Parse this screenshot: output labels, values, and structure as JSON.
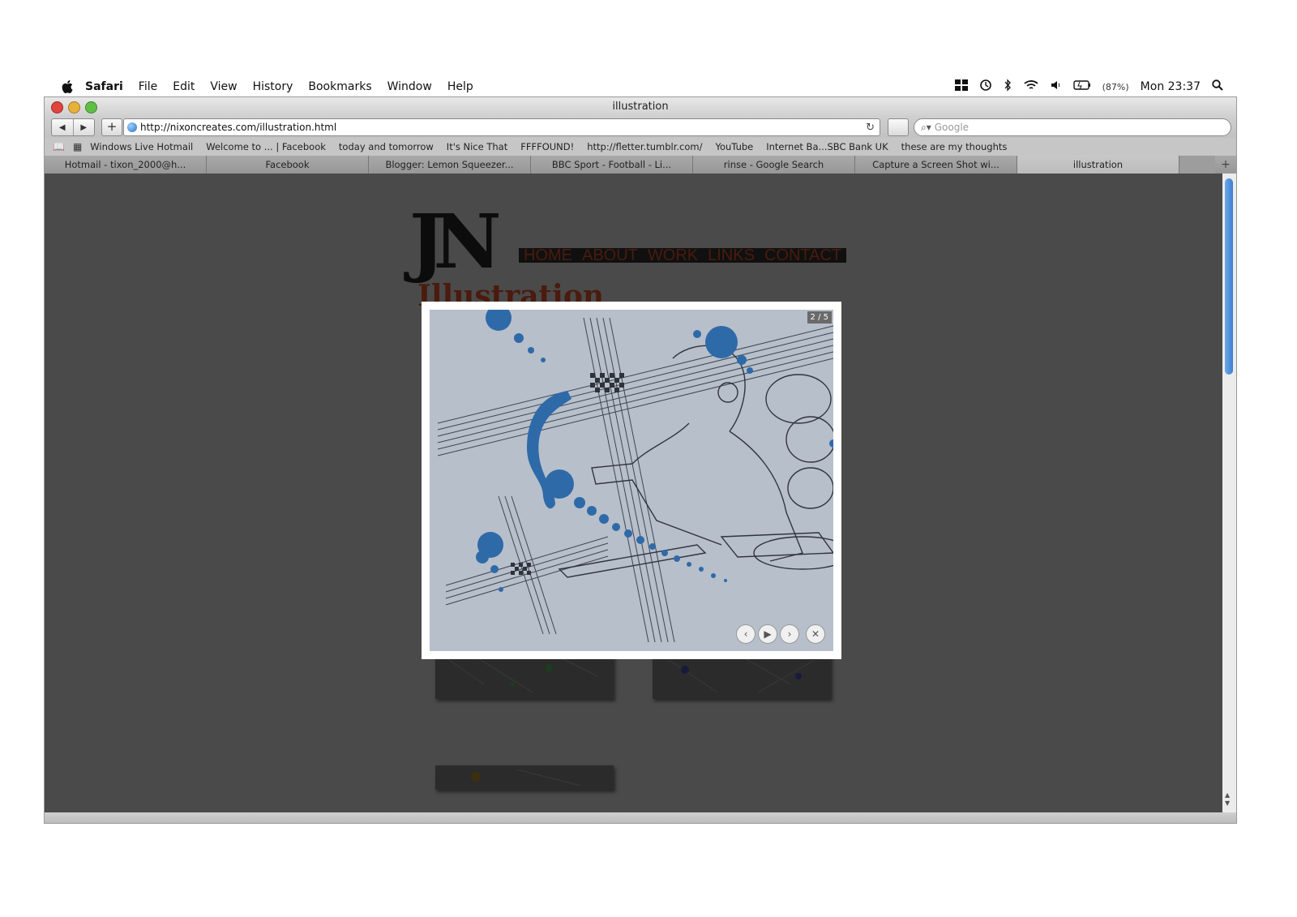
{
  "menubar": {
    "app": "Safari",
    "items": [
      "File",
      "Edit",
      "View",
      "History",
      "Bookmarks",
      "Window",
      "Help"
    ],
    "battery": "(87%)",
    "clock": "Mon 23:37",
    "icons": [
      "apple-icon",
      "spaces-icon",
      "time-machine-icon",
      "bluetooth-icon",
      "wifi-icon",
      "volume-icon",
      "battery-icon",
      "spotlight-icon"
    ]
  },
  "window": {
    "title": "illustration",
    "url": "http://nixoncreates.com/illustration.html",
    "search_placeholder": "Google"
  },
  "bookmarks": [
    "Windows Live Hotmail",
    "Welcome to ... | Facebook",
    "today and tomorrow",
    "It's Nice That",
    "FFFFOUND!",
    "http://fletter.tumblr.com/",
    "YouTube",
    "Internet Ba...SBC Bank UK",
    "these are my thoughts"
  ],
  "tabs": [
    {
      "label": "Hotmail - tixon_2000@h...",
      "active": false
    },
    {
      "label": "Facebook",
      "active": false
    },
    {
      "label": "Blogger: Lemon Squeezer...",
      "active": false
    },
    {
      "label": "BBC Sport - Football - Li...",
      "active": false
    },
    {
      "label": "rinse - Google Search",
      "active": false
    },
    {
      "label": "Capture a Screen Shot wi...",
      "active": false
    },
    {
      "label": "illustration",
      "active": true
    }
  ],
  "site": {
    "logo": "JN",
    "nav": [
      "HOME",
      "ABOUT",
      "WORK",
      "LINKS",
      "CONTACT"
    ],
    "heading": "Illustration"
  },
  "lightbox": {
    "counter": "2 / 5",
    "controls": [
      "previous-icon",
      "play-icon",
      "next-icon",
      "close-icon"
    ]
  }
}
